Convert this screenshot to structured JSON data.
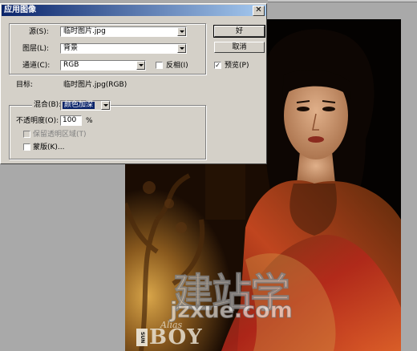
{
  "dialog": {
    "title": "应用图像",
    "close_glyph": "✕",
    "source_label": "源(S):",
    "source_value": "临时图片.jpg",
    "layer_label": "图层(L):",
    "layer_value": "背景",
    "channel_label": "通道(C):",
    "channel_value": "RGB",
    "invert_label": "反相(I)",
    "invert_checked": false,
    "target_label": "目标:",
    "target_value": "临时图片.jpg(RGB)",
    "blending_label": "混合(B):",
    "blending_value": "颜色加深",
    "opacity_label": "不透明度(O):",
    "opacity_value": "100",
    "opacity_unit": "%",
    "preserve_transparency_label": "保留透明区域(T)",
    "preserve_transparency_checked": false,
    "mask_label": "蒙版(K)...",
    "mask_checked": false,
    "ok_label": "好",
    "cancel_label": "取消",
    "preview_label": "预览(P)",
    "preview_checked": true,
    "check_glyph": "✓"
  },
  "photo": {
    "magazine_logo": "BOY",
    "magazine_script": "Alias",
    "magazine_side": "SUN",
    "watermark_cn": "建站学",
    "watermark_url": "jzxue.com"
  },
  "colors": {
    "workspace": "#a9a9a9",
    "dialog_face": "#d4d0c8",
    "title_start": "#0a246a",
    "title_end": "#a6caf0",
    "selection": "#0a246a"
  }
}
